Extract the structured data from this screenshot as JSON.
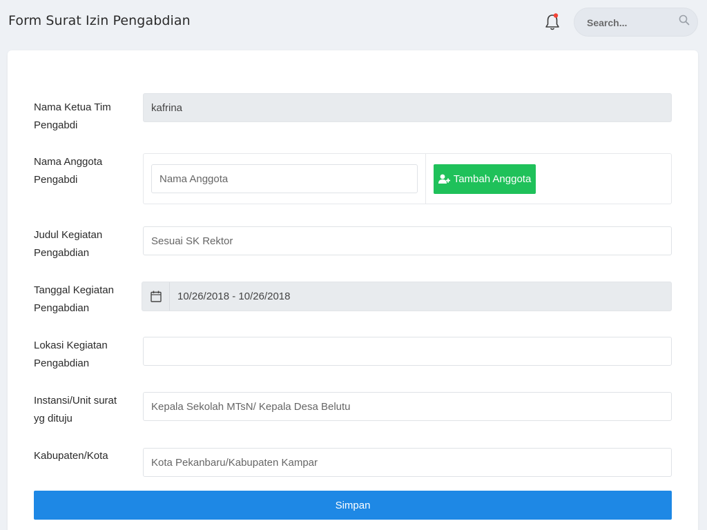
{
  "header": {
    "title": "Form Surat Izin Pengabdian",
    "search_placeholder": "Search...",
    "icons": {
      "notification": "bell-icon",
      "search": "search-icon"
    },
    "notification_dot_color": "#f44336"
  },
  "form": {
    "ketua": {
      "label": "Nama Ketua Tim Pengabdi",
      "value": "kafrina"
    },
    "anggota": {
      "label": "Nama Anggota Pengabdi",
      "placeholder": "Nama Anggota",
      "add_button": "Tambah Anggota",
      "add_icon": "user-plus-icon"
    },
    "judul": {
      "label": "Judul Kegiatan Pengabdian",
      "placeholder": "Sesuai SK Rektor"
    },
    "tanggal": {
      "label": "Tanggal Kegiatan Pengabdian",
      "value": "10/26/2018 - 10/26/2018",
      "icon": "calendar-icon"
    },
    "lokasi": {
      "label": "Lokasi Kegiatan Pengabdian",
      "value": ""
    },
    "instansi": {
      "label": "Instansi/Unit surat yg dituju",
      "placeholder": "Kepala Sekolah MTsN/ Kepala Desa Belutu"
    },
    "kabupaten": {
      "label": "Kabupaten/Kota",
      "placeholder": "Kota Pekanbaru/Kabupaten Kampar"
    },
    "submit_label": "Simpan"
  },
  "colors": {
    "accent_blue": "#1e88e5",
    "accent_green": "#1fc15a"
  }
}
